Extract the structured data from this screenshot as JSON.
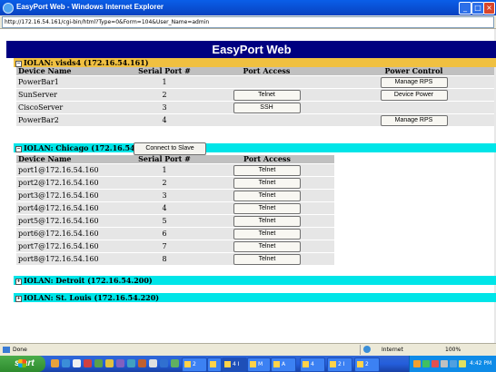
{
  "window": {
    "title": "EasyPort Web - Windows Internet Explorer",
    "address": "http://172.16.54.161/cgi-bin/html?Type=0&Form=104&User_Name=admin"
  },
  "page": {
    "banner": "EasyPort Web"
  },
  "groups": [
    {
      "title": "IOLAN: visds4 (172.16.54.161)",
      "headers": {
        "device": "Device Name",
        "serial": "Serial Port #",
        "access": "Port Access",
        "power": "Power Control"
      },
      "rows": [
        {
          "device": "PowerBar1",
          "serial": "1",
          "access": "",
          "power": "Manage RPS"
        },
        {
          "device": "SunServer",
          "serial": "2",
          "access": "Telnet",
          "power": "Device Power"
        },
        {
          "device": "CiscoServer",
          "serial": "3",
          "access": "SSH",
          "power": ""
        },
        {
          "device": "PowerBar2",
          "serial": "4",
          "access": "",
          "power": "Manage RPS"
        }
      ]
    },
    {
      "title": "IOLAN: Chicago (172.16.54.160)",
      "connect_label": "Connect to Slave",
      "headers": {
        "device": "Device Name",
        "serial": "Serial Port #",
        "access": "Port Access"
      },
      "rows": [
        {
          "device": "port1@172.16.54.160",
          "serial": "1",
          "access": "Telnet"
        },
        {
          "device": "port2@172.16.54.160",
          "serial": "2",
          "access": "Telnet"
        },
        {
          "device": "port3@172.16.54.160",
          "serial": "3",
          "access": "Telnet"
        },
        {
          "device": "port4@172.16.54.160",
          "serial": "4",
          "access": "Telnet"
        },
        {
          "device": "port5@172.16.54.160",
          "serial": "5",
          "access": "Telnet"
        },
        {
          "device": "port6@172.16.54.160",
          "serial": "6",
          "access": "Telnet"
        },
        {
          "device": "port7@172.16.54.160",
          "serial": "7",
          "access": "Telnet"
        },
        {
          "device": "port8@172.16.54.160",
          "serial": "8",
          "access": "Telnet"
        }
      ]
    },
    {
      "title": "IOLAN: Detroit (172.16.54.200)"
    },
    {
      "title": "IOLAN: St. Louis (172.16.54.220)"
    }
  ],
  "statusbar": {
    "text": "Done",
    "zone": "Internet",
    "zoom": "100%"
  },
  "taskbar": {
    "start_label": "start",
    "buttons": [
      "2",
      "",
      "4 I",
      "M",
      "A",
      "4",
      "2 I",
      "2"
    ],
    "clock": "4:42 PM"
  },
  "colors": {
    "banner": "#000080",
    "group_gold": "#f0c040",
    "group_cyan": "#00e5e8",
    "header_gray": "#c0c0c0"
  }
}
